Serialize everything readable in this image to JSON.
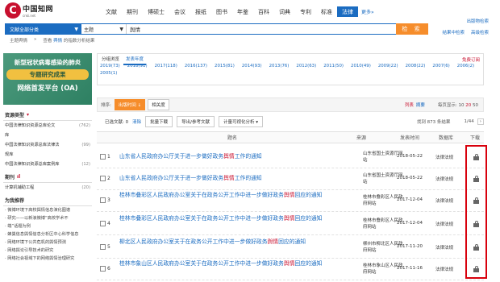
{
  "logo": {
    "mark": "C",
    "name": "中国知网",
    "sub": "cnki.net"
  },
  "nav": {
    "items": [
      "文献",
      "期刊",
      "博硕士",
      "会议",
      "报纸",
      "图书",
      "年鉴",
      "百科",
      "词典",
      "专利",
      "标准",
      "法律"
    ],
    "active_index": 11,
    "more": "更多»"
  },
  "toplinks": {
    "publish": "出版物检索",
    "results": "结果中检索",
    "advanced": "高级检索"
  },
  "search": {
    "scope": "文献全部分类",
    "field": "主题",
    "query": "舆情",
    "button": "检 索"
  },
  "breadcrumb": {
    "theme": "主题舆情",
    "arrow": "»",
    "view": "查看",
    "kw": "舆情",
    "suffix": "的指数分析结果"
  },
  "banner": {
    "line1": "新型冠状病毒感染的肺炎",
    "line2": "专题研究成果",
    "line3": "网络首发平台 (OA)"
  },
  "sidebar": {
    "resource_head": "资源类型",
    "resources": [
      {
        "label": "中国法律知识资源总库论文",
        "count": "(762)"
      },
      {
        "label": "库",
        "count": ""
      },
      {
        "label": "中国法律知识资源总库法律法",
        "count": "(99)"
      },
      {
        "label": "规库",
        "count": ""
      },
      {
        "label": "中国法律知识资源总库案例库",
        "count": "(12)"
      }
    ],
    "journal_head": "期刊",
    "journals": [
      {
        "label": "计算机辅助工程",
        "count": "(20)"
      }
    ],
    "recommend_head": "为我推荐",
    "recommends": [
      "微博环境下高校舆情信息演化图谱",
      "研究——以新浪微博“高校学术不",
      "端”话题为例",
      "蜂巢信息舆情信息分析区中心科学信息",
      "网络环境下公共危机的舆情预测",
      "网络舆论引导技术的研究",
      "网络社会视域下的网络舆情治理研究"
    ]
  },
  "filter": {
    "tabs": [
      "分组浏览",
      "发表年度"
    ],
    "active_tab": 1,
    "subscribe": "免费订阅",
    "years": [
      "2019(73)",
      "2018(91)",
      "2017(118)",
      "2016(137)",
      "2015(81)",
      "2014(93)",
      "2013(76)",
      "2012(63)",
      "2011(50)",
      "2010(49)",
      "2009(22)",
      "2008(22)",
      "2007(6)",
      "2006(2)",
      "2005(1)"
    ]
  },
  "sortbar": {
    "label": "排序:",
    "options": [
      "出版时间",
      "相关度"
    ],
    "active_index": 0,
    "view_list": "列表",
    "view_summary": "摘要",
    "perpage_label": "每页显示:",
    "perpage_opts": [
      "10",
      "20",
      "50"
    ],
    "perpage_active": 1
  },
  "actions": {
    "selected": "已选文献:",
    "selected_count": "0",
    "clear": "清除",
    "batch": "批量下载",
    "export": "导出/参考文献",
    "visual": "计量可视化分析",
    "result_count": "找到 873 条结果",
    "page": "1/44"
  },
  "table": {
    "headers": {
      "title": "题名",
      "source": "来源",
      "date": "发表时间",
      "db": "数据库",
      "dl": "下载"
    },
    "rows": [
      {
        "num": "1",
        "title_a": "山东省人民政府办公厅关于进一步做好政务",
        "title_kw": "舆情",
        "title_b": "工作的通知",
        "source": "山东省国土资源厅网站",
        "date": "2018-05-22",
        "db": "法律法规"
      },
      {
        "num": "2",
        "title_a": "山东省人民政府办公厅关于进一步做好政务",
        "title_kw": "舆情",
        "title_b": "工作的通知",
        "source": "山东省国土资源厅网站",
        "date": "2018-05-22",
        "db": "法律法规"
      },
      {
        "num": "3",
        "title_a": "桂林市叠彩区人民政府办公室关于在政务公开工作中进一步做好政务",
        "title_kw": "舆情",
        "title_b": "回应的通知",
        "source": "桂林市叠彩区人民政府网站",
        "date": "2017-12-04",
        "db": "法律法规"
      },
      {
        "num": "4",
        "title_a": "桂林市叠彩区人民政府办公室关于在政务公开工作中进一步做好政务",
        "title_kw": "舆情",
        "title_b": "回应的通知",
        "source": "桂林市叠彩区人民政府网站",
        "date": "2017-12-04",
        "db": "法律法规"
      },
      {
        "num": "5",
        "title_a": "柳北区人民政府办公室关于在政务公开工作中进一步做好政务",
        "title_kw": "舆情",
        "title_b": "回应的通知",
        "source": "柳州市柳北区人民政府网站",
        "date": "2017-11-20",
        "db": "法律法规"
      },
      {
        "num": "6",
        "title_a": "桂林市象山区人民政府办公室关于在政务公开工作中进一步做好政务",
        "title_kw": "舆情",
        "title_b": "回应的通知",
        "source": "桂林市象山区人民政府网站",
        "date": "2017-11-16",
        "db": "法律法规"
      }
    ]
  },
  "colors": {
    "brand_blue": "#1b6cc1",
    "accent_orange": "#f68d2b",
    "highlight_red": "#d8000c"
  }
}
